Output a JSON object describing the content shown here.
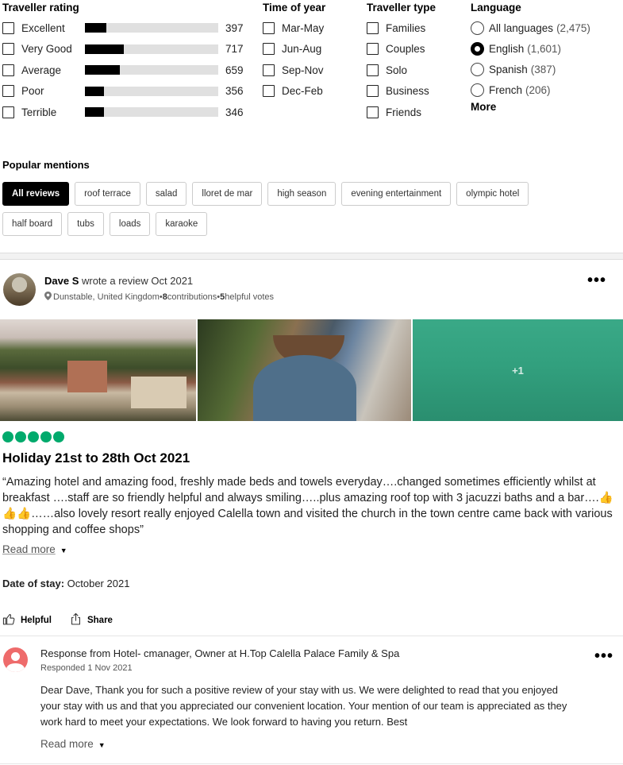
{
  "filters": {
    "traveller_rating": {
      "title": "Traveller rating",
      "items": [
        {
          "label": "Excellent",
          "count": "397",
          "fill_fraction": 0.16
        },
        {
          "label": "Very Good",
          "count": "717",
          "fill_fraction": 0.29
        },
        {
          "label": "Average",
          "count": "659",
          "fill_fraction": 0.26
        },
        {
          "label": "Poor",
          "count": "356",
          "fill_fraction": 0.14
        },
        {
          "label": "Terrible",
          "count": "346",
          "fill_fraction": 0.14
        }
      ]
    },
    "time_of_year": {
      "title": "Time of year",
      "items": [
        "Mar-May",
        "Jun-Aug",
        "Sep-Nov",
        "Dec-Feb"
      ]
    },
    "traveller_type": {
      "title": "Traveller type",
      "items": [
        "Families",
        "Couples",
        "Solo",
        "Business",
        "Friends"
      ]
    },
    "language": {
      "title": "Language",
      "items": [
        {
          "label": "All languages",
          "count": "(2,475)",
          "selected": false
        },
        {
          "label": "English",
          "count": "(1,601)",
          "selected": true
        },
        {
          "label": "Spanish",
          "count": "(387)",
          "selected": false
        },
        {
          "label": "French",
          "count": "(206)",
          "selected": false
        }
      ],
      "more_label": "More"
    }
  },
  "mentions": {
    "title": "Popular mentions",
    "chips": [
      "All reviews",
      "roof terrace",
      "salad",
      "lloret de mar",
      "high season",
      "evening entertainment",
      "olympic hotel",
      "half board",
      "tubs",
      "loads",
      "karaoke"
    ],
    "active_index": 0
  },
  "review": {
    "author": "Dave S",
    "wrote_text": " wrote a review Oct 2021",
    "location": "Dunstable, United Kingdom",
    "contributions_count": "8",
    "contributions_label": " contributions",
    "separator": " • ",
    "helpful_count": "5",
    "helpful_label": " helpful votes",
    "more_photos_label": "+1",
    "rating": 5,
    "rating_color": "#00aa6c",
    "title": "Holiday 21st to 28th Oct 2021",
    "body": "“Amazing hotel and amazing food, freshly made beds and towels everyday….changed sometimes efficiently whilst at breakfast ….staff are so friendly helpful and always smiling…..plus amazing roof top with 3 jacuzzi baths and a bar….👍👍👍……also lovely resort really enjoyed Calella town and visited the church in the town centre came back with various shopping and coffee shops”",
    "read_more": "Read more",
    "date_of_stay_label": "Date of stay:",
    "date_of_stay_value": " October 2021",
    "helpful_button": "Helpful",
    "share_button": "Share"
  },
  "response": {
    "title": "Response from Hotel- cmanager, Owner at H.Top Calella Palace Family & Spa",
    "date": "Responded 1 Nov 2021",
    "body": "Dear Dave, Thank you for such a positive review of your stay with us. We were delighted to read that you enjoyed your stay with us and that you appreciated our convenient location. Your mention of our team is appreciated as they work hard to meet your expectations. We look forward to having you return. Best",
    "read_more": "Read more"
  }
}
